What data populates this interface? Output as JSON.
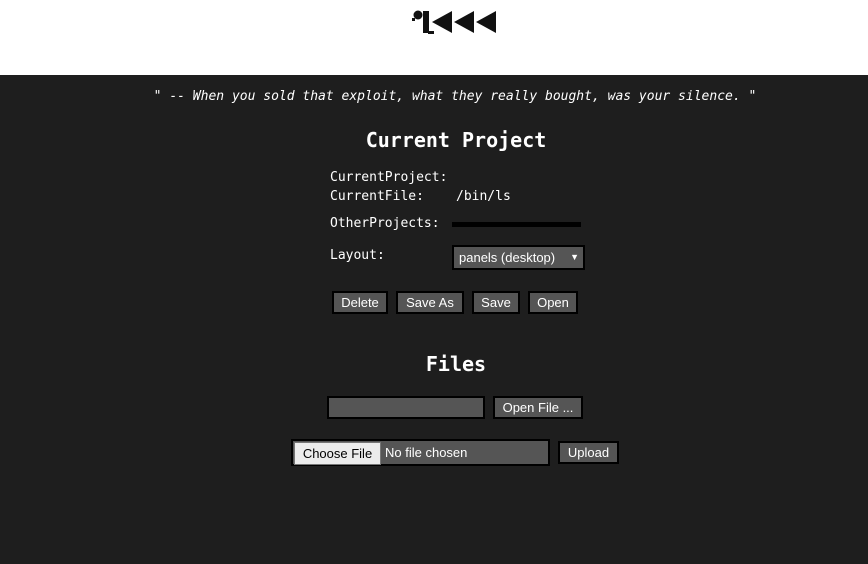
{
  "header": {
    "logo_icon": "rewind-logo-icon"
  },
  "quote": "\" -- When you sold that exploit, what they really bought, was your silence. \"",
  "current_project": {
    "title": "Current Project",
    "current_project_label": "CurrentProject:",
    "current_project_value": "",
    "current_file_label": "CurrentFile:",
    "current_file_value": "/bin/ls",
    "other_projects_label": "OtherProjects:",
    "layout_label": "Layout:",
    "layout_selected": "panels (desktop)",
    "buttons": {
      "delete": "Delete",
      "save_as": "Save As",
      "save": "Save",
      "open": "Open"
    }
  },
  "files": {
    "title": "Files",
    "open_file_button": "Open File ...",
    "choose_file_button": "Choose File",
    "no_file_chosen": "No file chosen",
    "upload_button": "Upload"
  },
  "colors": {
    "background": "#1e1e1e",
    "header_bg": "#ffffff",
    "control_bg": "#555555",
    "border": "#000000",
    "text": "#ffffff"
  }
}
